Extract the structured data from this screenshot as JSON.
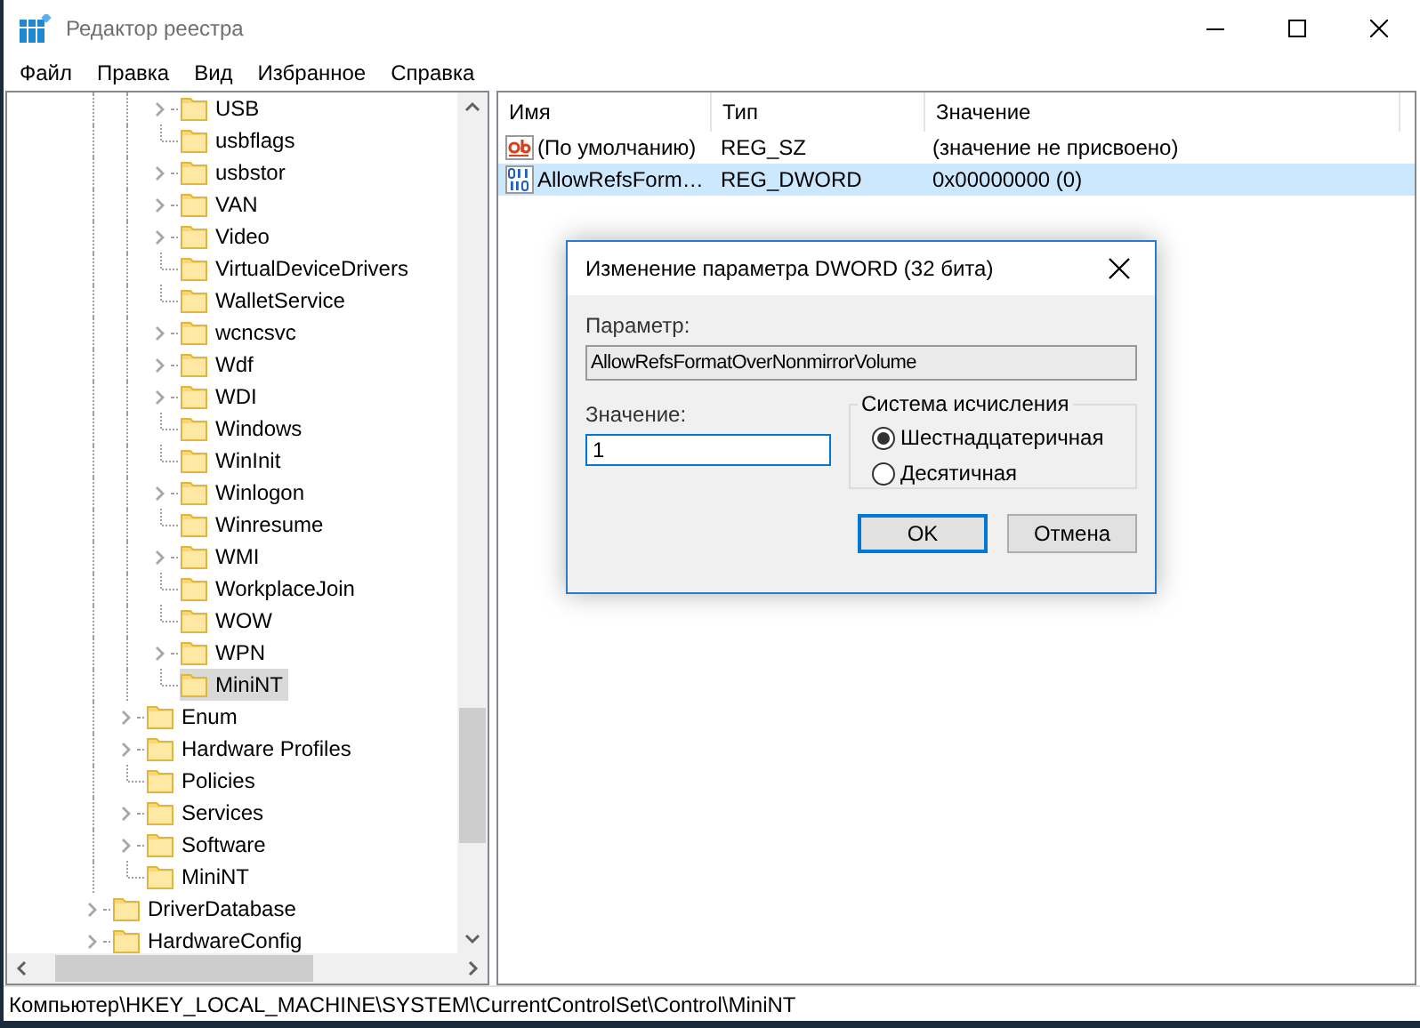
{
  "window": {
    "title": "Редактор реестра"
  },
  "menu": [
    "Файл",
    "Правка",
    "Вид",
    "Избранное",
    "Справка"
  ],
  "tree": {
    "items": [
      {
        "children": [
          {
            "children": [
              {
                "label": "USB",
                "expandable": true,
                "selected": false
              },
              {
                "label": "usbflags",
                "expandable": false,
                "selected": false
              },
              {
                "label": "usbstor",
                "expandable": true,
                "selected": false
              },
              {
                "label": "VAN",
                "expandable": true,
                "selected": false
              },
              {
                "label": "Video",
                "expandable": true,
                "selected": false
              },
              {
                "label": "VirtualDeviceDrivers",
                "expandable": false,
                "selected": false
              },
              {
                "label": "WalletService",
                "expandable": false,
                "selected": false
              },
              {
                "label": "wcncsvc",
                "expandable": true,
                "selected": false
              },
              {
                "label": "Wdf",
                "expandable": true,
                "selected": false
              },
              {
                "label": "WDI",
                "expandable": true,
                "selected": false
              },
              {
                "label": "Windows",
                "expandable": false,
                "selected": false
              },
              {
                "label": "WinInit",
                "expandable": false,
                "selected": false
              },
              {
                "label": "Winlogon",
                "expandable": true,
                "selected": false
              },
              {
                "label": "Winresume",
                "expandable": false,
                "selected": false
              },
              {
                "label": "WMI",
                "expandable": true,
                "selected": false
              },
              {
                "label": "WorkplaceJoin",
                "expandable": false,
                "selected": false
              },
              {
                "label": "WOW",
                "expandable": false,
                "selected": false
              },
              {
                "label": "WPN",
                "expandable": true,
                "selected": false
              },
              {
                "label": "MiniNT",
                "expandable": false,
                "selected": true
              }
            ]
          },
          {
            "label": "Enum",
            "expandable": true,
            "selected": false
          },
          {
            "label": "Hardware Profiles",
            "expandable": true,
            "selected": false
          },
          {
            "label": "Policies",
            "expandable": false,
            "selected": false
          },
          {
            "label": "Services",
            "expandable": true,
            "selected": false
          },
          {
            "label": "Software",
            "expandable": true,
            "selected": false
          },
          {
            "label": "MiniNT",
            "expandable": false,
            "selected": false
          }
        ]
      },
      {
        "label": "DriverDatabase",
        "expandable": true,
        "selected": false
      },
      {
        "label": "HardwareConfig",
        "expandable": true,
        "selected": false
      }
    ]
  },
  "values_table": {
    "columns": [
      "Имя",
      "Тип",
      "Значение"
    ],
    "rows": [
      {
        "kind": "string",
        "name": "(По умолчанию)",
        "type": "REG_SZ",
        "data": "(значение не присвоено)",
        "selected": false
      },
      {
        "kind": "binary",
        "name": "AllowRefsForm…",
        "type": "REG_DWORD",
        "data": "0x00000000 (0)",
        "selected": true
      }
    ]
  },
  "dialog": {
    "title": "Изменение параметра DWORD (32 бита)",
    "name_label": "Параметр:",
    "name_value": "AllowRefsFormatOverNonmirrorVolume",
    "value_label": "Значение:",
    "value": "1",
    "base_group": {
      "title": "Система исчисления",
      "options": [
        {
          "label": "Шестнадцатеричная",
          "selected": true
        },
        {
          "label": "Десятичная",
          "selected": false
        }
      ]
    },
    "buttons": [
      {
        "label": "OK",
        "default": true
      },
      {
        "label": "Отмена",
        "default": false
      }
    ]
  },
  "status_bar": "Компьютер\\HKEY_LOCAL_MACHINE\\SYSTEM\\CurrentControlSet\\Control\\MiniNT"
}
